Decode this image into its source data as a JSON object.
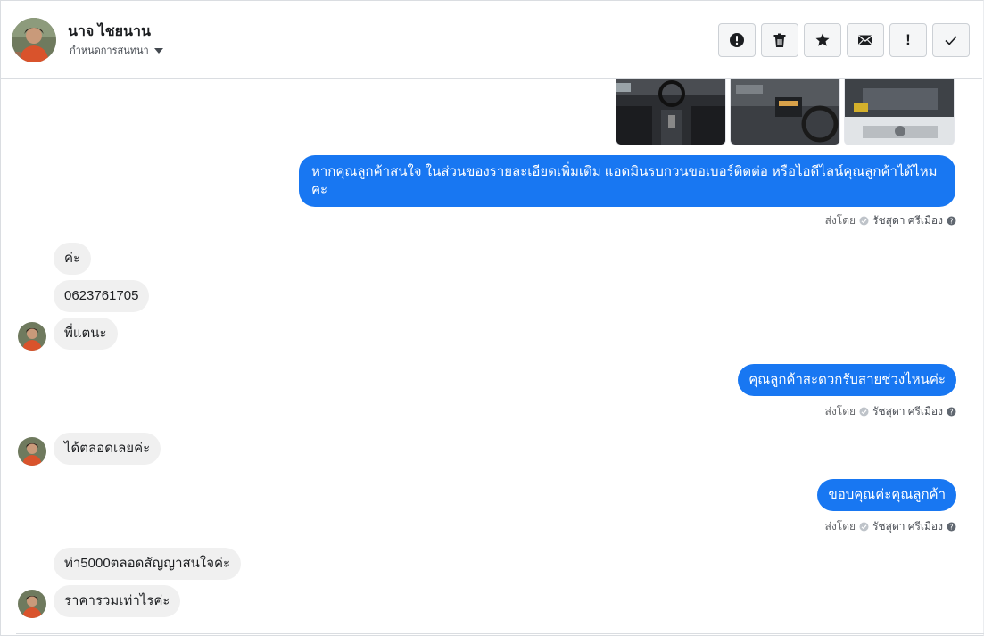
{
  "header": {
    "contact_name": "นาจ ไชยนาน",
    "subtitle": "กำหนดการสนทนา",
    "actions": [
      {
        "icon": "alert-circle-icon",
        "name": "report-button"
      },
      {
        "icon": "trash-icon",
        "name": "delete-button"
      },
      {
        "icon": "star-icon",
        "name": "star-button"
      },
      {
        "icon": "envelope-icon",
        "name": "mark-unread-button"
      },
      {
        "icon": "exclamation-icon",
        "name": "spam-button",
        "glyph": "!"
      },
      {
        "icon": "check-icon",
        "name": "done-button"
      }
    ]
  },
  "images": [
    {
      "icon": "car-interior-image",
      "alt": "car interior"
    },
    {
      "icon": "car-dashboard-image",
      "alt": "car dashboard"
    },
    {
      "icon": "car-engine-image",
      "alt": "car engine"
    }
  ],
  "messages": [
    {
      "id": "m1",
      "direction": "out",
      "text": "หากคุณลูกค้าสนใจ ในส่วนของรายละเอียดเพิ่มเติม แอดมินรบกวนขอเบอร์ติดต่อ หรือไอดีไลน์คุณลูกค้าได้ไหมคะ"
    },
    {
      "id": "m2",
      "direction": "in",
      "text": "ค่ะ"
    },
    {
      "id": "m3",
      "direction": "in",
      "text": "0623761705"
    },
    {
      "id": "m4",
      "direction": "in",
      "text": "พี่แตนะ"
    },
    {
      "id": "m5",
      "direction": "out",
      "text": "คุณลูกค้าสะดวกรับสายช่วงไหนค่ะ"
    },
    {
      "id": "m6",
      "direction": "in",
      "text": "ได้ตลอดเลยค่ะ"
    },
    {
      "id": "m7",
      "direction": "out",
      "text": "ขอบคุณค่ะคุณลูกค้า"
    },
    {
      "id": "m8",
      "direction": "in",
      "text": "ท่า5000ตลอดสัญญาสนใจค่ะ"
    },
    {
      "id": "m9",
      "direction": "in",
      "text": "ราคารวมเท่าไรค่ะ"
    }
  ],
  "sent_by": {
    "prefix": "ส่งโดย",
    "agent": "รัชสุดา ศรีเมือง"
  },
  "colors": {
    "outgoing_bubble": "#1877f2",
    "incoming_bubble": "#f0f0f0"
  }
}
